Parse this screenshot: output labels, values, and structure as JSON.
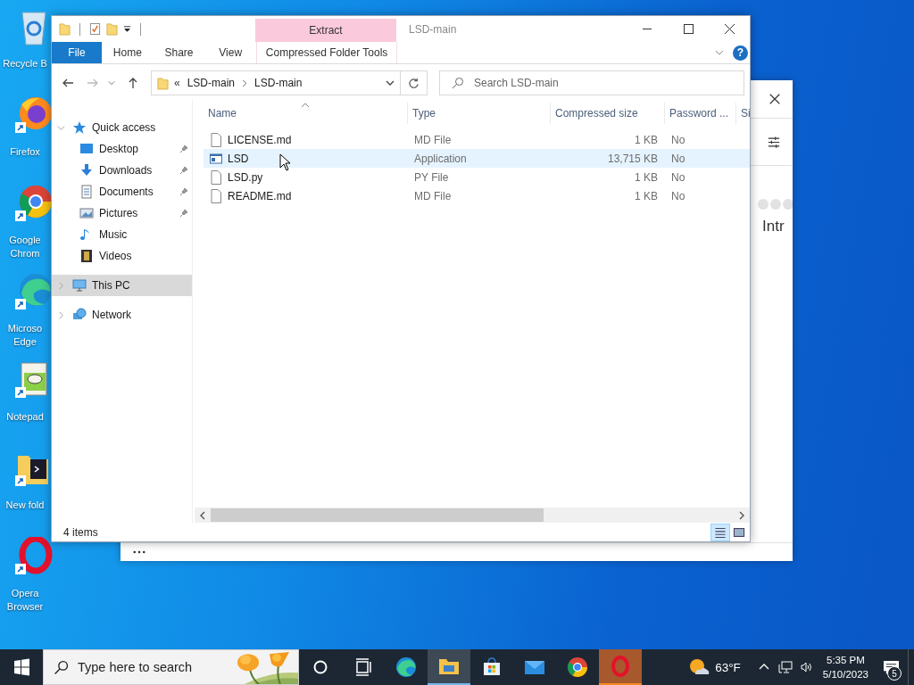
{
  "desktop_icons": [
    {
      "kind": "recycle",
      "label": "Recycle B"
    },
    {
      "kind": "firefox",
      "label": "Firefox"
    },
    {
      "kind": "chrome",
      "label": "Google Chrom"
    },
    {
      "kind": "edge",
      "label": "Microso Edge"
    },
    {
      "kind": "notepad",
      "label": "Notepad"
    },
    {
      "kind": "folder",
      "label": "New fold"
    },
    {
      "kind": "opera",
      "label": "Opera Browser"
    }
  ],
  "background_window": {
    "heading": "Intr"
  },
  "explorer": {
    "title": "LSD-main",
    "context_group": "Extract",
    "help": "?",
    "ribbon_tabs": [
      {
        "label": "File",
        "kind": "file"
      },
      {
        "label": "Home",
        "kind": "plain"
      },
      {
        "label": "Share",
        "kind": "plain"
      },
      {
        "label": "View",
        "kind": "plain"
      },
      {
        "label": "Compressed Folder Tools",
        "kind": "context"
      }
    ],
    "address": {
      "overflow": "«",
      "crumbs": [
        "LSD-main",
        "LSD-main"
      ]
    },
    "search": {
      "placeholder": "Search LSD-main"
    },
    "nav": [
      {
        "label": "Quick access",
        "kind": "star",
        "expanded": true,
        "selected": false,
        "children": [
          {
            "label": "Desktop",
            "kind": "desktop",
            "pinned": true,
            "selected": false
          },
          {
            "label": "Downloads",
            "kind": "downloads",
            "pinned": true,
            "selected": false
          },
          {
            "label": "Documents",
            "kind": "documents",
            "pinned": true,
            "selected": false
          },
          {
            "label": "Pictures",
            "kind": "pictures",
            "pinned": true,
            "selected": false
          },
          {
            "label": "Music",
            "kind": "music",
            "pinned": false,
            "selected": false
          },
          {
            "label": "Videos",
            "kind": "videos",
            "pinned": false,
            "selected": false
          }
        ]
      },
      {
        "label": "This PC",
        "kind": "pc",
        "expanded": false,
        "selected": true
      },
      {
        "label": "Network",
        "kind": "network",
        "expanded": false,
        "selected": false
      }
    ],
    "columns": [
      {
        "label": "Name",
        "sorted": true
      },
      {
        "label": "Type",
        "sorted": false
      },
      {
        "label": "Compressed size",
        "sorted": false
      },
      {
        "label": "Password ...",
        "sorted": false
      },
      {
        "label": "Si",
        "sorted": false
      }
    ],
    "rows": [
      {
        "name": "LICENSE.md",
        "kind": "file",
        "type": "MD File",
        "size": "1 KB",
        "password": "No",
        "selected": false
      },
      {
        "name": "LSD",
        "kind": "app",
        "type": "Application",
        "size": "13,715 KB",
        "password": "No",
        "selected": true
      },
      {
        "name": "LSD.py",
        "kind": "file",
        "type": "PY File",
        "size": "1 KB",
        "password": "No",
        "selected": false
      },
      {
        "name": "README.md",
        "kind": "file",
        "type": "MD File",
        "size": "1 KB",
        "password": "No",
        "selected": false
      }
    ],
    "status": "4 items",
    "views": [
      {
        "kind": "details",
        "selected": true
      },
      {
        "kind": "tiles",
        "selected": false
      }
    ]
  },
  "taskbar": {
    "search_placeholder": "Type here to search",
    "apps": [
      {
        "kind": "edge",
        "active": false,
        "flashing": false
      },
      {
        "kind": "explorer",
        "active": true,
        "flashing": false
      },
      {
        "kind": "store",
        "active": false,
        "flashing": false
      },
      {
        "kind": "mail",
        "active": false,
        "flashing": false
      },
      {
        "kind": "chrome",
        "active": false,
        "flashing": false
      },
      {
        "kind": "opera",
        "active": false,
        "flashing": true
      }
    ],
    "weather": "63°F",
    "time": "5:35 PM",
    "date": "5/10/2023",
    "notifications": "5"
  }
}
